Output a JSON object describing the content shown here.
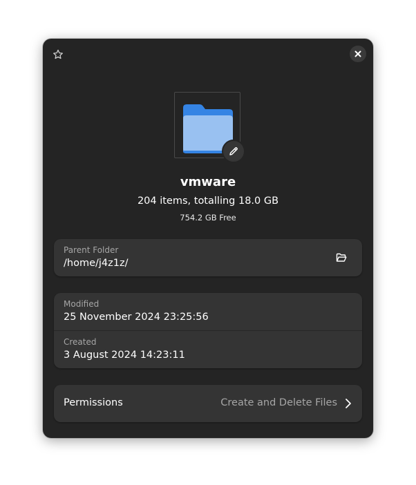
{
  "folder": {
    "name": "vmware",
    "summary": "204 items, totalling 18.0 GB",
    "free_space": "754.2 GB Free",
    "icon": "folder-icon"
  },
  "header": {
    "star_icon": "star-icon",
    "close_icon": "close-icon"
  },
  "parent_folder": {
    "label": "Parent Folder",
    "value": "/home/j4z1z/",
    "open_icon": "open-folder-icon"
  },
  "dates": {
    "modified_label": "Modified",
    "modified_value": "25 November 2024 23:25:56",
    "created_label": "Created",
    "created_value": "3 August 2024 14:23:11"
  },
  "permissions": {
    "label": "Permissions",
    "value": "Create and Delete Files"
  },
  "colors": {
    "dialog_bg": "#242424",
    "card_bg": "#343434",
    "folder_blue": "#3584e4",
    "folder_light": "#99c1f1",
    "dim_text": "#a6a6a6"
  }
}
